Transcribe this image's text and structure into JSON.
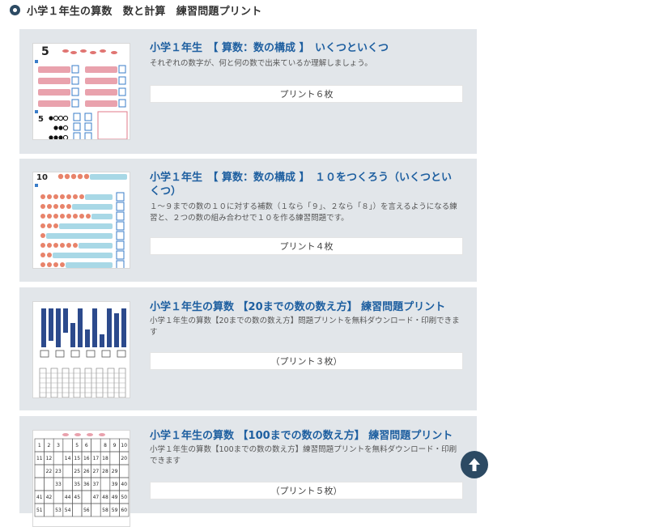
{
  "section": {
    "title": "小学１年生の算数　数と計算　練習問題プリント"
  },
  "cards": [
    {
      "title": "小学１年生　【 算数：数の構成 】　いくつといくつ",
      "description": "それぞれの数字が、何と何の数で出来ているか理解しましょう。",
      "button": "プリント６枚"
    },
    {
      "title": "小学１年生　【 算数：数の構成 】　１０をつくろう（いくつといくつ）",
      "description": "１～９までの数の１０に対する補数（１なら「９」、２なら「８」）を言えるようになる練習と、２つの数の組み合わせで１０を作る練習問題です。",
      "button": "プリント４枚"
    },
    {
      "title": "小学１年生の算数 【20までの数の数え方】 練習問題プリント",
      "description": "小学１年生の算数【20までの数の数え方】問題プリントを無料ダウンロード・印刷できます",
      "button": "（プリント３枚）"
    },
    {
      "title": "小学１年生の算数 【100までの数の数え方】 練習問題プリント",
      "description": "小学１年生の算数【100までの数の数え方】練習問題プリントを無料ダウンロード・印刷できます",
      "button": "（プリント５枚）"
    }
  ],
  "thumbs": {
    "t1_number": "5",
    "t2_number": "10",
    "t4_rows": [
      [
        "1",
        "2",
        "3",
        "",
        "5",
        "6",
        "",
        "8",
        "9",
        "10"
      ],
      [
        "11",
        "12",
        "",
        "14",
        "15",
        "16",
        "17",
        "18",
        "",
        "20"
      ],
      [
        "",
        "22",
        "23",
        "",
        "25",
        "26",
        "27",
        "28",
        "29",
        ""
      ],
      [
        "",
        "",
        "33",
        "",
        "35",
        "36",
        "37",
        "",
        "39",
        "40"
      ],
      [
        "41",
        "42",
        "",
        "44",
        "45",
        "",
        "47",
        "48",
        "49",
        "50"
      ],
      [
        "51",
        "",
        "53",
        "54",
        "",
        "56",
        "",
        "58",
        "59",
        "60"
      ]
    ]
  },
  "colors": {
    "accent": "#2c4a63",
    "title": "#1e5fa0",
    "card_bg": "#e2e6ea"
  },
  "icons": {
    "section_bullet": "circle-bullet-icon",
    "back_to_top": "arrow-up-icon"
  }
}
